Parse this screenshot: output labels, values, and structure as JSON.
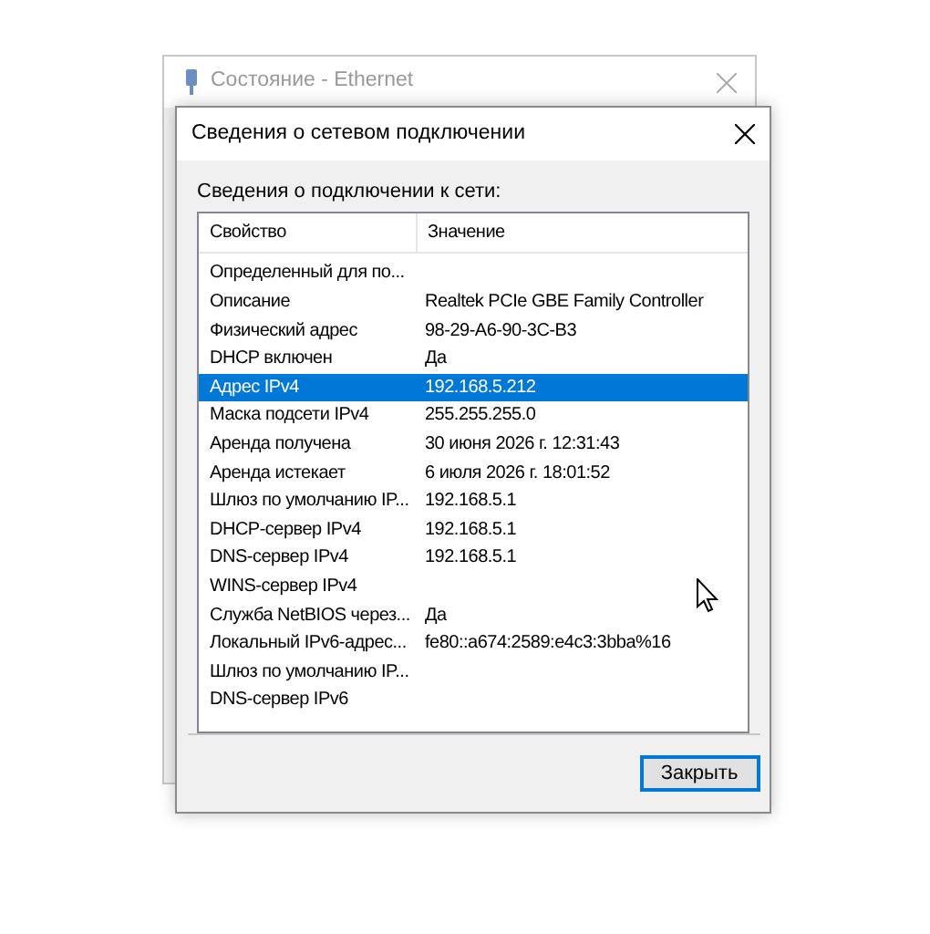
{
  "back_window": {
    "title": "Состояние - Ethernet"
  },
  "dialog": {
    "title": "Сведения о сетевом подключении",
    "section_label": "Сведения о подключении к сети:",
    "table": {
      "columns": [
        "Свойство",
        "Значение"
      ],
      "rows": [
        {
          "property": "Определенный для по...",
          "value": "",
          "selected": false
        },
        {
          "property": "Описание",
          "value": "Realtek PCIe GBE Family Controller",
          "selected": false
        },
        {
          "property": "Физический адрес",
          "value": "98-29-A6-90-3C-B3",
          "selected": false
        },
        {
          "property": "DHCP включен",
          "value": "Да",
          "selected": false
        },
        {
          "property": "Адрес IPv4",
          "value": "192.168.5.212",
          "selected": true
        },
        {
          "property": "Маска подсети IPv4",
          "value": "255.255.255.0",
          "selected": false
        },
        {
          "property": "Аренда получена",
          "value": "30 июня 2026 г. 12:31:43",
          "selected": false
        },
        {
          "property": "Аренда истекает",
          "value": "6 июля 2026 г. 18:01:52",
          "selected": false
        },
        {
          "property": "Шлюз по умолчанию IP...",
          "value": "192.168.5.1",
          "selected": false
        },
        {
          "property": "DHCP-сервер IPv4",
          "value": "192.168.5.1",
          "selected": false
        },
        {
          "property": "DNS-сервер IPv4",
          "value": "192.168.5.1",
          "selected": false
        },
        {
          "property": "WINS-сервер IPv4",
          "value": "",
          "selected": false
        },
        {
          "property": "Служба NetBIOS через...",
          "value": "Да",
          "selected": false
        },
        {
          "property": "Локальный IPv6-адрес...",
          "value": "fe80::a674:2589:e4c3:3bba%16",
          "selected": false
        },
        {
          "property": "Шлюз по умолчанию IP...",
          "value": "",
          "selected": false
        },
        {
          "property": "DNS-сервер IPv6",
          "value": "",
          "selected": false
        }
      ]
    },
    "buttons": [
      "Закрыть"
    ]
  }
}
